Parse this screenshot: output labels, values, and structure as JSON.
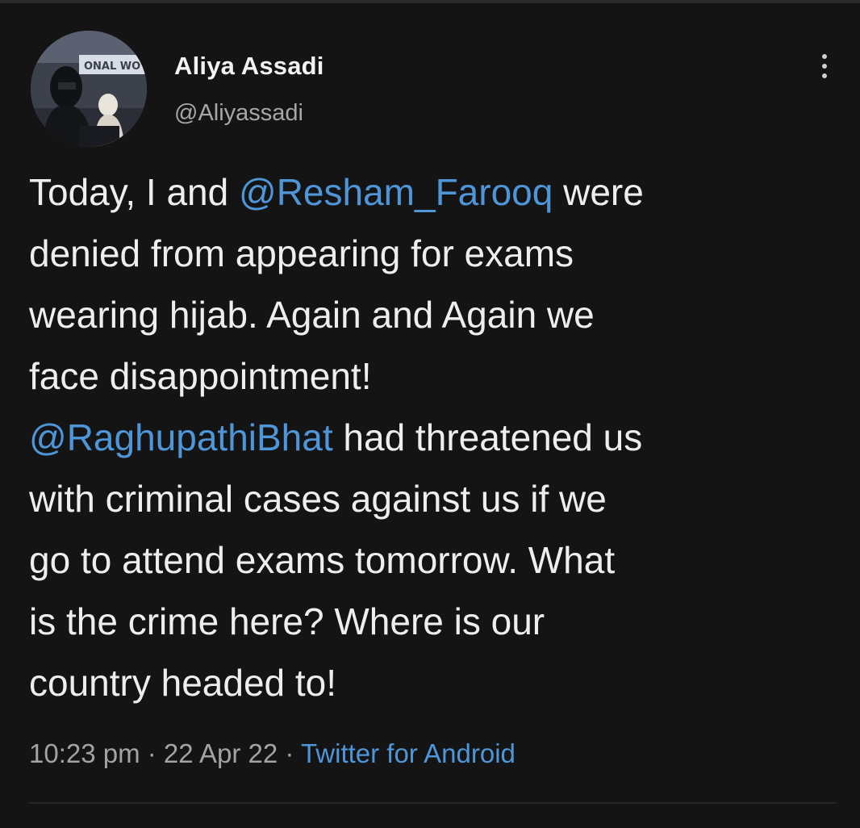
{
  "author": {
    "name": "Aliya Assadi",
    "handle": "@Aliyassadi",
    "avatar_banner_text": "ONAL WO"
  },
  "menu": {
    "icon": "more-vertical-icon"
  },
  "tweet": {
    "lines": [
      [
        {
          "t": "Today, I and "
        },
        {
          "t": "@Resham_Farooq",
          "mention": true
        },
        {
          "t": " were"
        }
      ],
      [
        {
          "t": "denied from appearing for exams"
        }
      ],
      [
        {
          "t": "wearing hijab. Again and Again we"
        }
      ],
      [
        {
          "t": "face disappointment!"
        }
      ],
      [
        {
          "t": "@RaghupathiBhat",
          "mention": true
        },
        {
          "t": " had threatened us"
        }
      ],
      [
        {
          "t": "with criminal cases against us if we"
        }
      ],
      [
        {
          "t": "go to attend exams tomorrow. What"
        }
      ],
      [
        {
          "t": "is the crime here? Where is our"
        }
      ],
      [
        {
          "t": "country headed to!"
        }
      ]
    ]
  },
  "meta": {
    "time": "10:23 pm",
    "separator": " · ",
    "date": "22 Apr 22",
    "source": "Twitter for Android"
  },
  "colors": {
    "background": "#141414",
    "text": "#eeeeee",
    "secondary": "#a3a3a3",
    "link": "#4f96d9"
  }
}
